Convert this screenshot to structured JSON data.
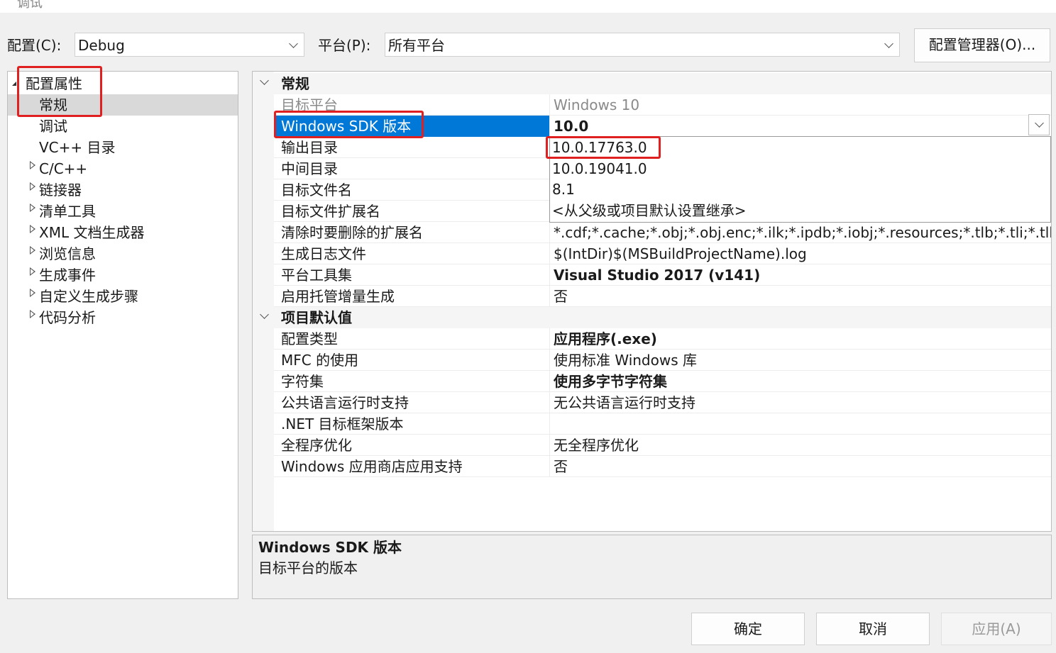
{
  "window": {
    "title_fragment": "调试"
  },
  "toolbar": {
    "config_label": "配置(C):",
    "config_value": "Debug",
    "platform_label": "平台(P):",
    "platform_value": "所有平台",
    "config_manager_button": "配置管理器(O)..."
  },
  "tree": {
    "root": "配置属性",
    "items": [
      {
        "label": "常规",
        "expandable": false,
        "selected": true
      },
      {
        "label": "调试",
        "expandable": false
      },
      {
        "label": "VC++ 目录",
        "expandable": false
      },
      {
        "label": "C/C++",
        "expandable": true
      },
      {
        "label": "链接器",
        "expandable": true
      },
      {
        "label": "清单工具",
        "expandable": true
      },
      {
        "label": "XML 文档生成器",
        "expandable": true
      },
      {
        "label": "浏览信息",
        "expandable": true
      },
      {
        "label": "生成事件",
        "expandable": true
      },
      {
        "label": "自定义生成步骤",
        "expandable": true
      },
      {
        "label": "代码分析",
        "expandable": true
      }
    ]
  },
  "grid": {
    "sections": [
      {
        "title": "常规",
        "rows": [
          {
            "key": "目标平台",
            "value": "Windows 10",
            "dim": true
          },
          {
            "key": "Windows SDK 版本",
            "value": "10.0",
            "bold": true,
            "selected": true
          },
          {
            "key": "输出目录",
            "value": ""
          },
          {
            "key": "中间目录",
            "value": ""
          },
          {
            "key": "目标文件名",
            "value": ""
          },
          {
            "key": "目标文件扩展名",
            "value": ""
          },
          {
            "key": "清除时要删除的扩展名",
            "value": "*.cdf;*.cache;*.obj;*.obj.enc;*.ilk;*.ipdb;*.iobj;*.resources;*.tlb;*.tli;*.tlh;*"
          },
          {
            "key": "生成日志文件",
            "value": "$(IntDir)$(MSBuildProjectName).log"
          },
          {
            "key": "平台工具集",
            "value": "Visual Studio 2017 (v141)",
            "bold": true
          },
          {
            "key": "启用托管增量生成",
            "value": "否"
          }
        ]
      },
      {
        "title": "项目默认值",
        "rows": [
          {
            "key": "配置类型",
            "value": "应用程序(.exe)",
            "bold": true
          },
          {
            "key": "MFC 的使用",
            "value": "使用标准 Windows 库"
          },
          {
            "key": "字符集",
            "value": "使用多字节字符集",
            "bold": true
          },
          {
            "key": "公共语言运行时支持",
            "value": "无公共语言运行时支持"
          },
          {
            "key": ".NET 目标框架版本",
            "value": ""
          },
          {
            "key": "全程序优化",
            "value": "无全程序优化"
          },
          {
            "key": "Windows 应用商店应用支持",
            "value": "否"
          }
        ]
      }
    ]
  },
  "dropdown": {
    "options": [
      "10.0.17763.0",
      "10.0.19041.0",
      "8.1",
      "<从父级或项目默认设置继承>"
    ]
  },
  "description": {
    "title": "Windows SDK 版本",
    "text": "目标平台的版本"
  },
  "footer": {
    "ok": "确定",
    "cancel": "取消",
    "apply": "应用(A)"
  },
  "colors": {
    "selection": "#0078d7",
    "annotation": "#e02020"
  }
}
